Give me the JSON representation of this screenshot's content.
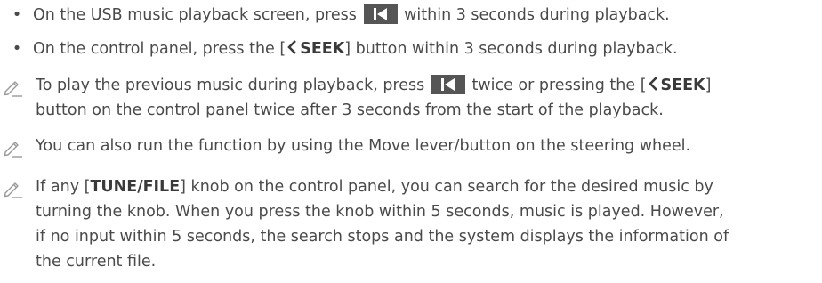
{
  "bullets": [
    {
      "before": "On the USB music playback screen, press",
      "button_icon": "previous-track-icon",
      "after": "within 3 seconds during playback."
    },
    {
      "before": "On the control panel, press the [",
      "chevron_icon": "chevron-left-icon",
      "bold": "SEEK",
      "after": "] button within 3 seconds during playback."
    }
  ],
  "notes": [
    {
      "icon": "pencil-note-icon",
      "line1_before": "To play the previous music during playback, press",
      "line1_mid": "twice or pressing the [",
      "line1_bold": "SEEK",
      "line1_end": "]",
      "line2": "button on the control panel twice after 3 seconds from the start of the playback."
    },
    {
      "icon": "pencil-note-icon",
      "text": "You can also run the function by using the Move lever/button on the steering wheel."
    },
    {
      "icon": "pencil-note-icon",
      "line1_before": "If any [",
      "line1_bold": "TUNE/FILE",
      "line1_after": "] knob on the control panel, you can search for the desired music by",
      "line2": "turning the knob. When you press the knob within 5 seconds, music is played. However,",
      "line3": "if no input within 5 seconds, the search stops and the system displays the information of",
      "line4": "the current file."
    }
  ],
  "colors": {
    "text": "#4a4a4a",
    "button_bg": "#555555",
    "icon_stroke": "#9a9a9a"
  }
}
